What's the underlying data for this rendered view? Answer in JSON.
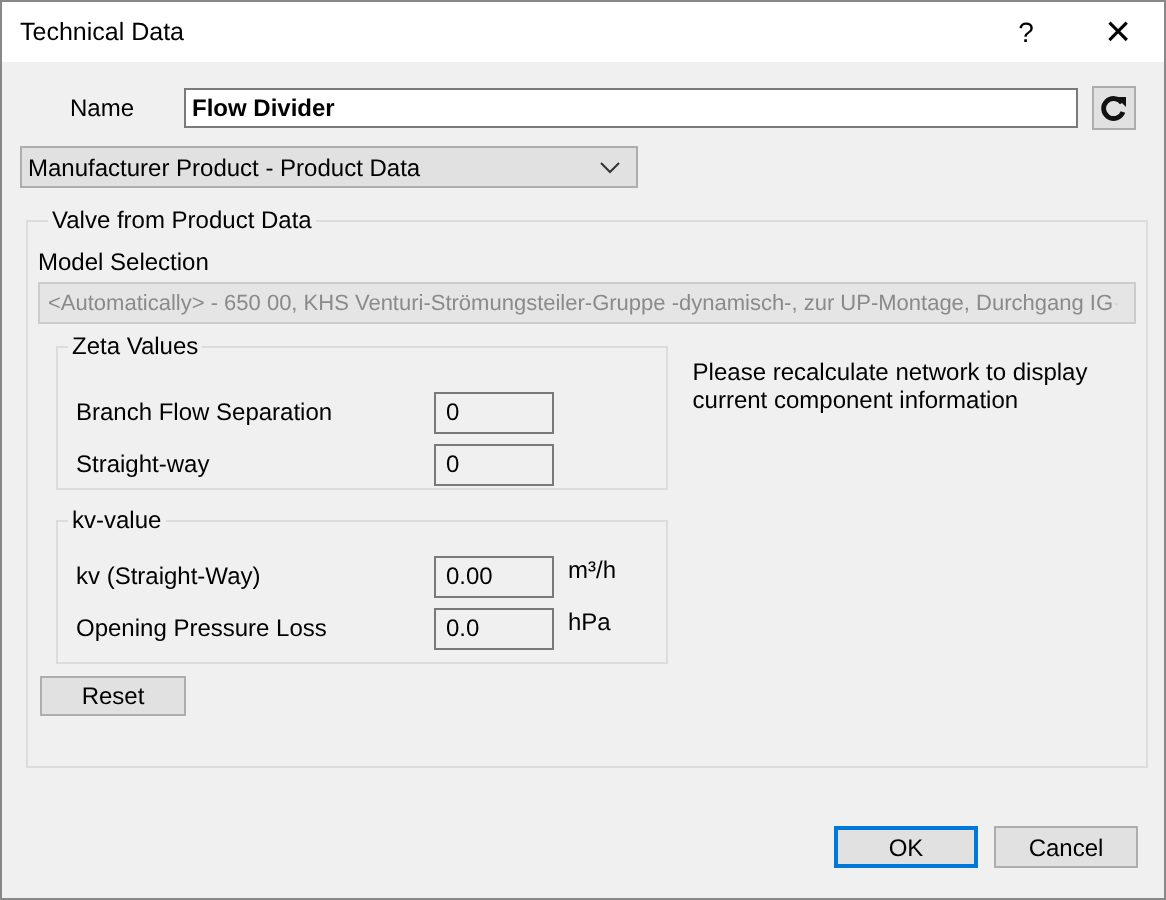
{
  "window": {
    "title": "Technical Data",
    "help": "?",
    "close": "×"
  },
  "name": {
    "label": "Name",
    "value": "Flow Divider"
  },
  "source": {
    "value": "Manufacturer Product - Product Data"
  },
  "valve_group": {
    "title": "Valve from Product Data",
    "model_label": "Model Selection",
    "model": {
      "value": "<Automatically> - 650 00, KHS Venturi-Strömungsteiler-Gruppe -dynamisch-, zur UP-Montage, Durchgang IG",
      "disabled": true
    },
    "zeta": {
      "title": "Zeta Values",
      "rows": [
        {
          "label": "Branch Flow Separation",
          "value": "0"
        },
        {
          "label": "Straight-way",
          "value": "0"
        }
      ]
    },
    "kv": {
      "title": "kv-value",
      "rows": [
        {
          "label": "kv (Straight-Way)",
          "value": "0.00",
          "unit": "m³/h"
        },
        {
          "label": "Opening Pressure Loss",
          "value": "0.0",
          "unit": "hPa"
        }
      ]
    },
    "reset": "Reset",
    "note": "Please recalculate network to display current component information"
  },
  "buttons": [
    {
      "label": "OK",
      "default": true
    },
    {
      "label": "Cancel",
      "default": false
    }
  ]
}
